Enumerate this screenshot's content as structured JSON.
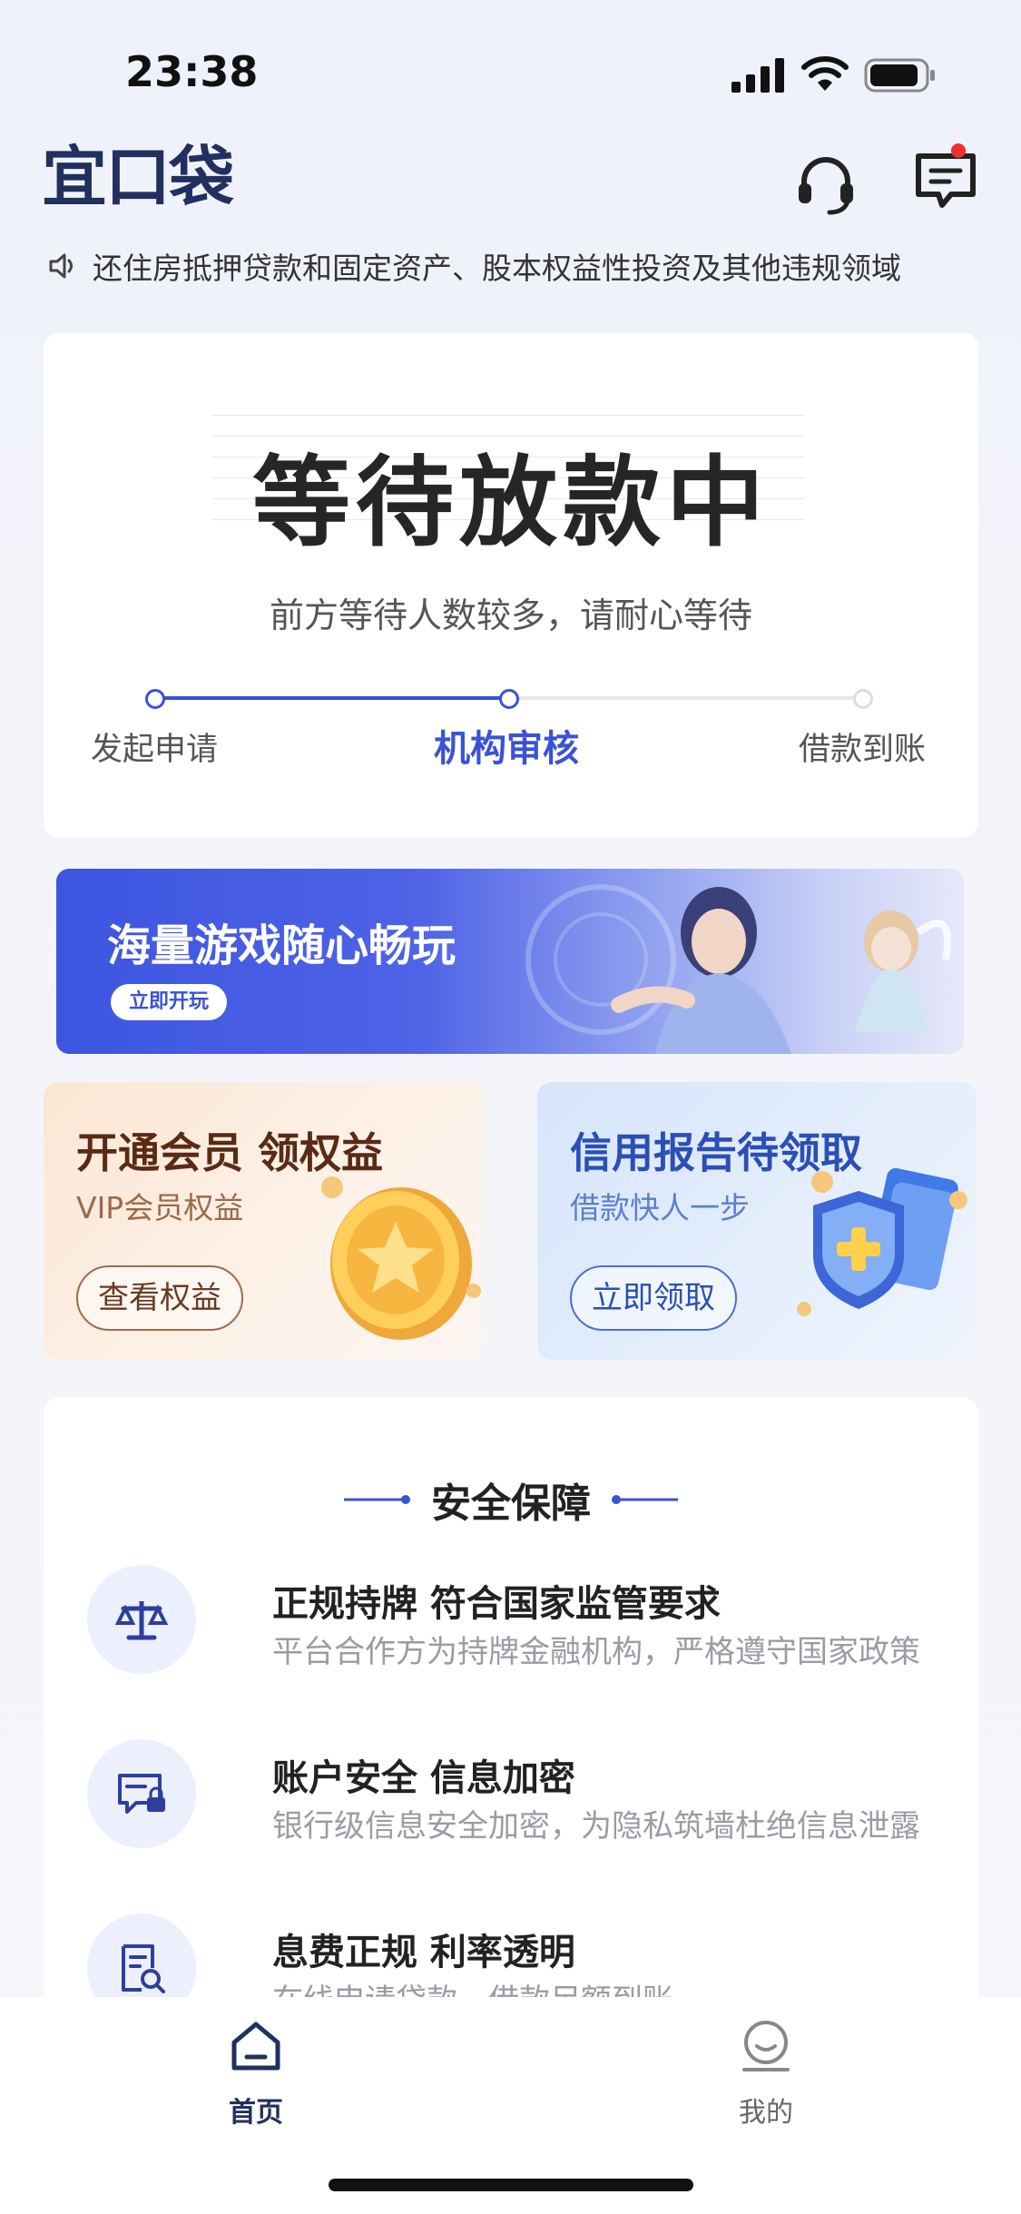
{
  "status_bar": {
    "time": "23:38"
  },
  "header": {
    "logo": "宜口袋"
  },
  "notice": {
    "text": "还住房抵押贷款和固定资产、股本权益性投资及其他违规领域"
  },
  "status_card": {
    "title": "等待放款中",
    "subtitle": "前方等待人数较多，请耐心等待",
    "progress": 0.5,
    "steps": [
      {
        "label": "发起申请",
        "state": "done"
      },
      {
        "label": "机构审核",
        "state": "active"
      },
      {
        "label": "借款到账",
        "state": "pending"
      }
    ]
  },
  "game_banner": {
    "title": "海量游戏随心畅玩",
    "button": "立即开玩"
  },
  "promos": {
    "vip": {
      "title": "开通会员 领权益",
      "subtitle": "VIP会员权益",
      "button": "查看权益"
    },
    "credit": {
      "title": "信用报告待领取",
      "subtitle": "借款快人一步",
      "button": "立即领取"
    }
  },
  "security": {
    "title": "安全保障",
    "items": [
      {
        "icon": "scale-icon",
        "title": "正规持牌 符合国家监管要求",
        "desc": "平台合作方为持牌金融机构，严格遵守国家政策"
      },
      {
        "icon": "secure-account-icon",
        "title": "账户安全 信息加密",
        "desc": "银行级信息安全加密，为隐私筑墙杜绝信息泄露"
      },
      {
        "icon": "document-search-icon",
        "title": "息费正规  利率透明",
        "desc": "在线申请贷款，借款足额到账"
      }
    ]
  },
  "tab_bar": {
    "tabs": [
      {
        "label": "首页",
        "active": true
      },
      {
        "label": "我的",
        "active": false
      }
    ]
  },
  "colors": {
    "accent": "#3a52d6",
    "brand": "#22305f",
    "notification": "#f0302a"
  }
}
